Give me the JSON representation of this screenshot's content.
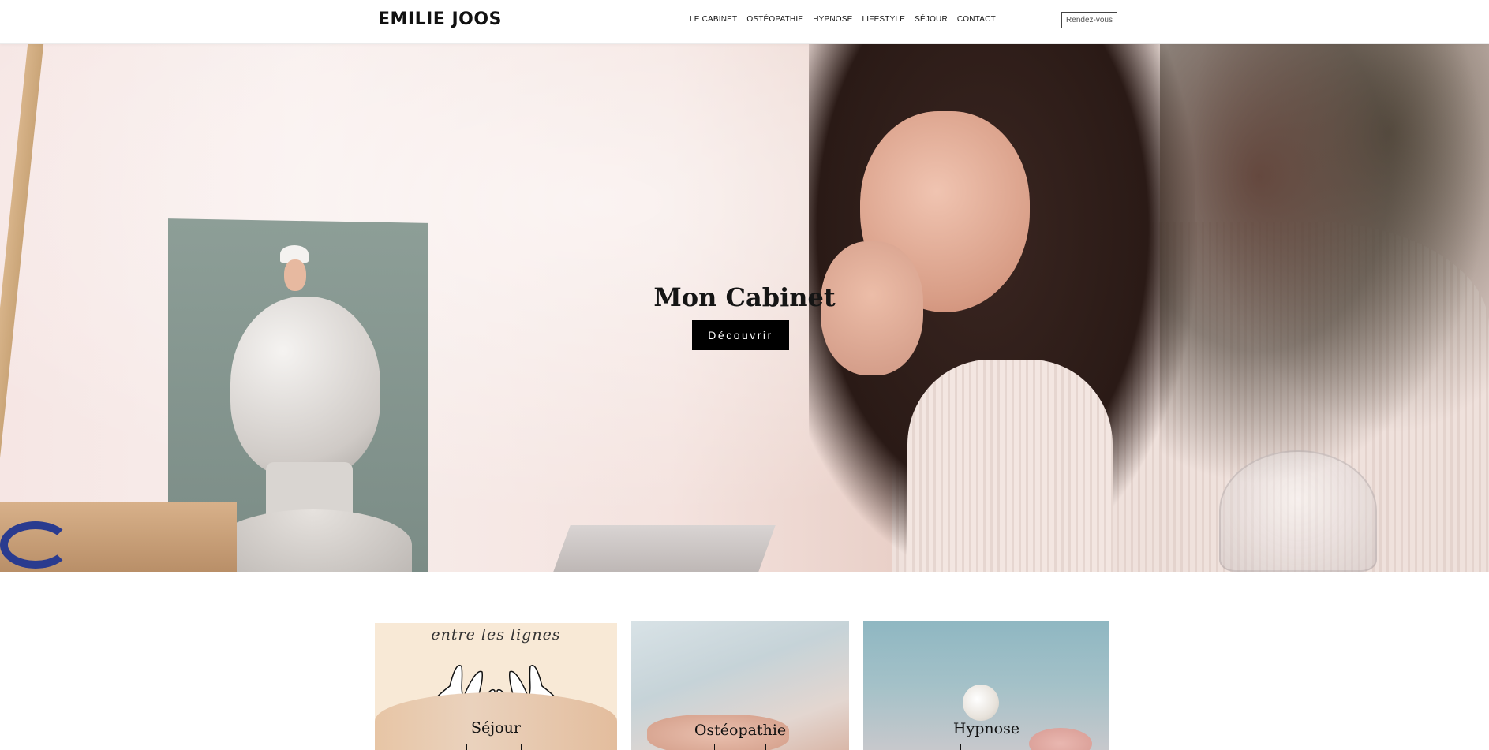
{
  "header": {
    "logo": "EMILIE JOOS",
    "nav": [
      "LE CABINET",
      "OSTÉOPATHIE",
      "HYPNOSE",
      "LIFESTYLE",
      "SÉJOUR",
      "CONTACT"
    ],
    "cta_label": "Rendez-vous"
  },
  "hero": {
    "title": "Mon Cabinet",
    "button_label": "Découvrir"
  },
  "cards": [
    {
      "script_text": "entre les lignes",
      "title": "Séjour"
    },
    {
      "title": "Ostéopathie"
    },
    {
      "title": "Hypnose"
    }
  ]
}
